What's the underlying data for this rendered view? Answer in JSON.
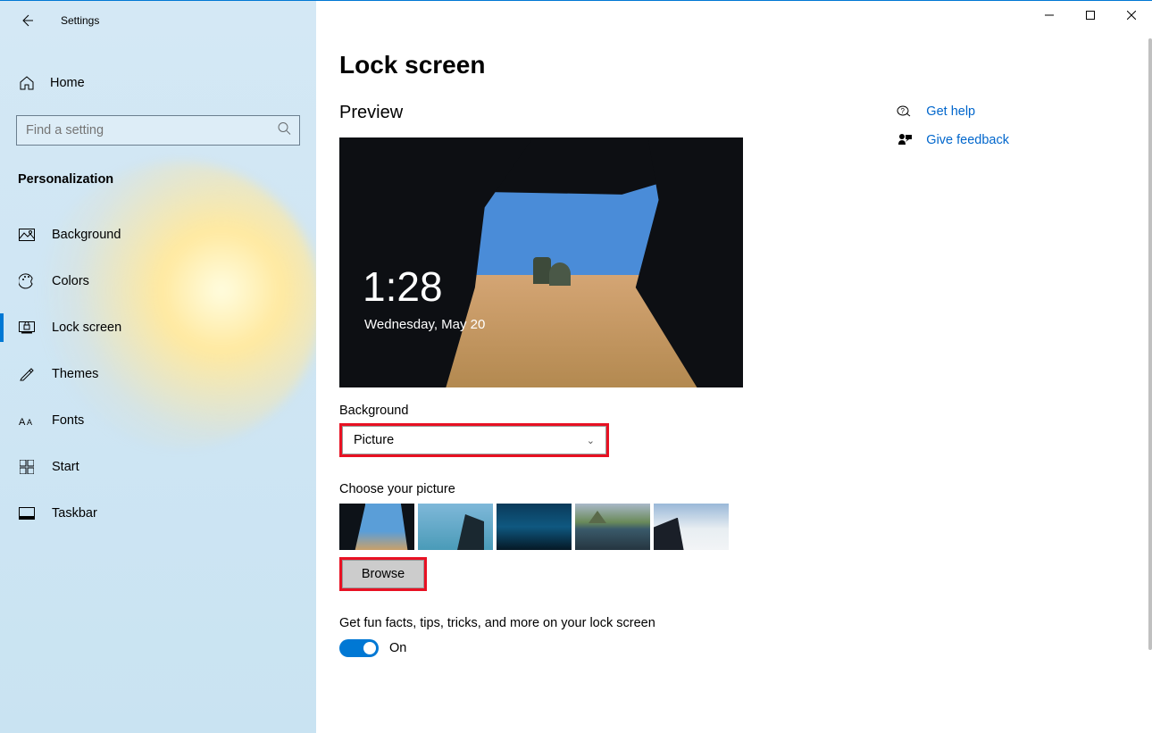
{
  "app": {
    "title": "Settings"
  },
  "sidebar": {
    "home": "Home",
    "search_placeholder": "Find a setting",
    "section": "Personalization",
    "items": [
      {
        "label": "Background"
      },
      {
        "label": "Colors"
      },
      {
        "label": "Lock screen"
      },
      {
        "label": "Themes"
      },
      {
        "label": "Fonts"
      },
      {
        "label": "Start"
      },
      {
        "label": "Taskbar"
      }
    ]
  },
  "main": {
    "title": "Lock screen",
    "preview_label": "Preview",
    "clock": "1:28",
    "date": "Wednesday, May 20",
    "background_label": "Background",
    "background_value": "Picture",
    "choose_label": "Choose your picture",
    "browse": "Browse",
    "funfacts_label": "Get fun facts, tips, tricks, and more on your lock screen",
    "toggle_value": "On"
  },
  "help": {
    "gethelp": "Get help",
    "feedback": "Give feedback"
  }
}
